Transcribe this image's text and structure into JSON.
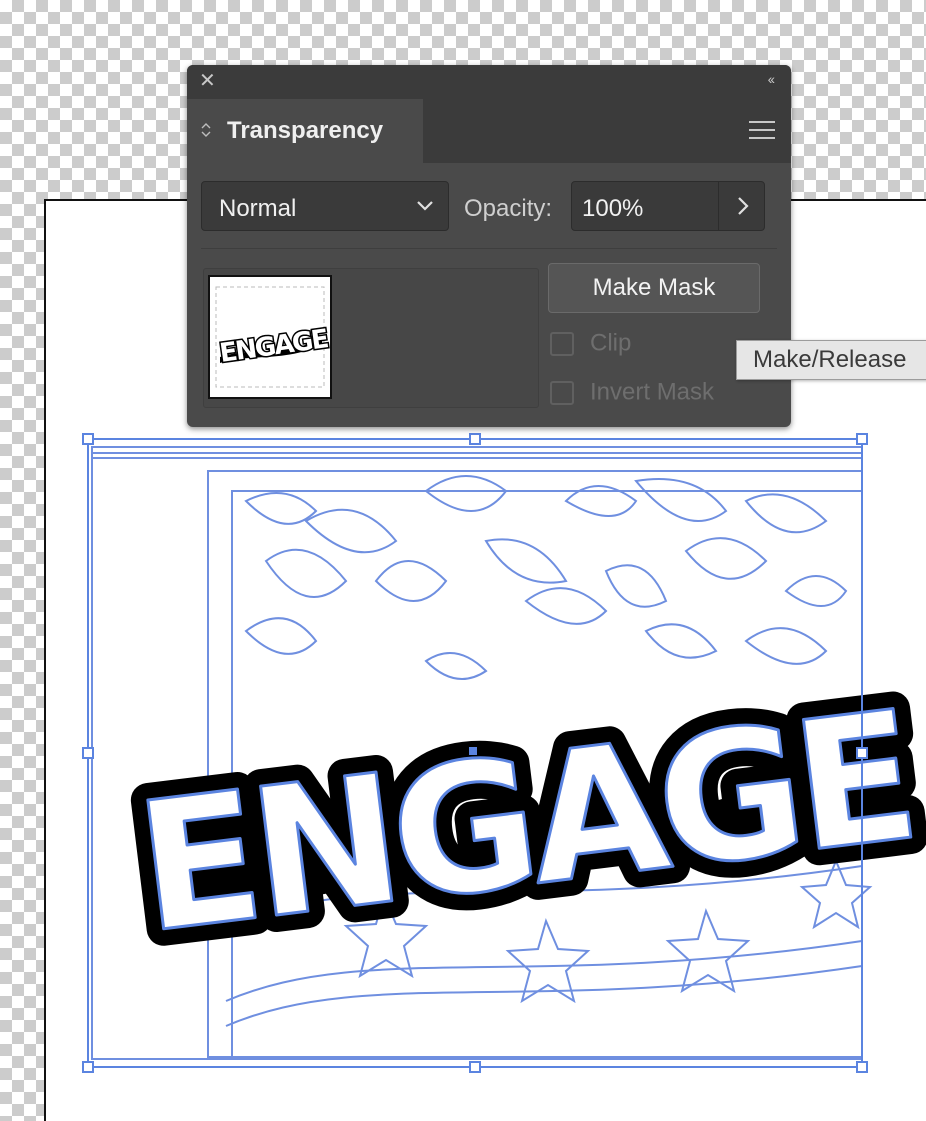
{
  "panel": {
    "close_glyph": "✕",
    "collapse_glyph": "‹‹",
    "tab": {
      "label": "Transparency",
      "icon": "expand-collapse-icon"
    },
    "menu_icon": "hamburger-menu-icon",
    "blend_mode": {
      "value": "Normal",
      "icon": "chevron-down-icon"
    },
    "opacity": {
      "label": "Opacity:",
      "value": "100%",
      "icon": "chevron-right-icon"
    },
    "make_mask_label": "Make Mask",
    "clip": {
      "label": "Clip",
      "checked": false,
      "enabled": false
    },
    "invert_mask": {
      "label": "Invert Mask",
      "checked": false,
      "enabled": false
    },
    "thumbnail_text": "ENGAGE"
  },
  "tooltip": {
    "text": "Make/Release"
  },
  "artwork": {
    "text": "ENGAGE",
    "selection_color": "#5b84e0",
    "outline_color": "#6f8fe0"
  }
}
